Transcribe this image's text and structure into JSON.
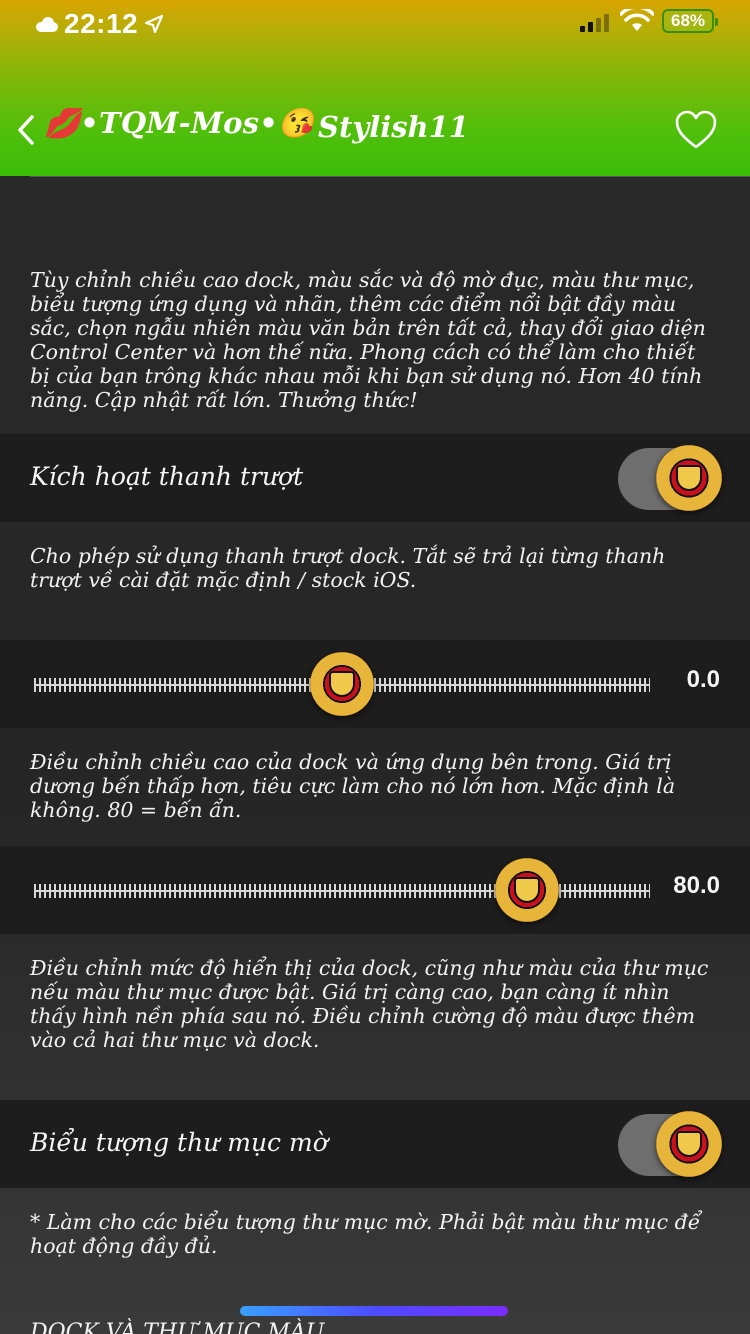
{
  "status": {
    "time": "22:12",
    "battery": "68%",
    "weather_icon": "cloud-icon",
    "location_icon": "location-arrow-icon",
    "signal_bars_on": 2,
    "signal_bars_total": 4
  },
  "nav": {
    "back_icon": "chevron-left-icon",
    "title": "💋•TQM-Mos•😘",
    "subtitle": "Stylish11",
    "favorite_icon": "heart-outline-icon"
  },
  "colors": {
    "header_top": "#d8a400",
    "header_bottom": "#3cbd08",
    "cell_bg": "#1d1d1d",
    "page_bg": "#262626",
    "toggle_track": "#6e6e6e"
  },
  "intro": "Tùy chỉnh chiều cao dock, màu sắc và độ mờ đục, màu thư mục, biểu tượng ứng dụng và nhãn, thêm các điểm nổi bật đầy màu sắc, chọn ngẫu nhiên màu văn bản trên tất cả, thay đổi giao diện Control Center và hơn thế nữa.  Phong cách có thể làm cho thiết bị của bạn trông khác nhau mỗi khi bạn sử dụng nó.  Hơn 40 tính năng.  Cập nhật rất lớn.  Thưởng thức!",
  "settings": {
    "enable_slider": {
      "label": "Kích hoạt thanh trượt",
      "on": true,
      "footer": "Cho phép sử dụng thanh trượt dock.  Tắt sẽ trả lại từng thanh trượt về cài đặt mặc định / stock iOS."
    },
    "dock_height": {
      "value": 0.0,
      "value_label": "0.0",
      "min": -100,
      "max": 100,
      "footer": "Điều chỉnh chiều cao của dock và ứng dụng bên trong.  Giá trị dương bến thấp hơn, tiêu cực làm cho nó lớn hơn.  Mặc định là không.  80 = bến ẩn."
    },
    "dock_opacity": {
      "value": 80.0,
      "value_label": "80.0",
      "min": 0,
      "max": 100,
      "footer": "Điều chỉnh mức độ hiển thị của dock, cũng như màu của thư mục nếu màu thư mục được bật.  Giá trị càng cao, bạn càng ít nhìn thấy hình nền phía sau nó.  Điều chỉnh cường độ màu được thêm vào cả hai thư mục và dock."
    },
    "blur_folder_icons": {
      "label": "Biểu tượng thư mục mờ",
      "on": true,
      "footer": "* Làm cho các biểu tượng thư mục mờ.  Phải bật màu thư mục để hoạt động đầy đủ."
    }
  },
  "next_section": "DOCK VÀ THƯ MỤC MÀU"
}
